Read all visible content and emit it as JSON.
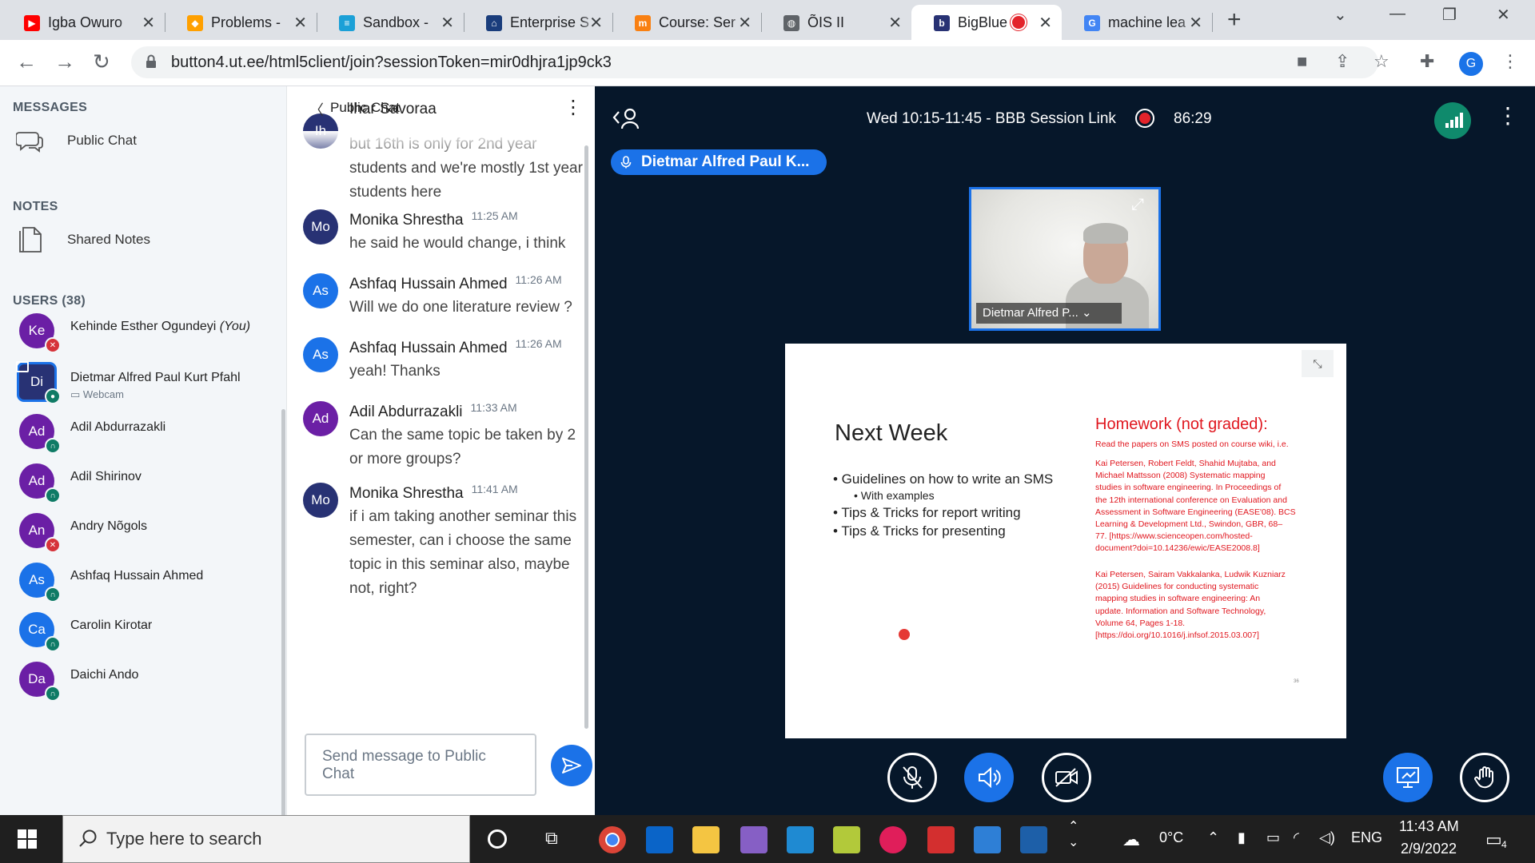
{
  "browser": {
    "tabs": [
      {
        "title": "Igba Owuro",
        "icon": "youtube-icon",
        "color": "#ff0000",
        "glyph": "▶"
      },
      {
        "title": "Problems -",
        "icon": "problems-icon",
        "color": "#ffa000",
        "glyph": "◆"
      },
      {
        "title": "Sandbox -",
        "icon": "cisco-icon",
        "color": "#1ba0d7",
        "glyph": "≡"
      },
      {
        "title": "Enterprise S",
        "icon": "building-icon",
        "color": "#1a3d7c",
        "glyph": "⌂"
      },
      {
        "title": "Course: Ser",
        "icon": "moodle-icon",
        "color": "#f98012",
        "glyph": "m"
      },
      {
        "title": "ÕIS II",
        "icon": "globe-icon",
        "color": "#5f6368",
        "glyph": "◍"
      },
      {
        "title": "BigBlue",
        "icon": "bigbluebutton-icon",
        "color": "#283274",
        "glyph": "b"
      },
      {
        "title": "machine lea",
        "icon": "google-icon",
        "color": "#4285f4",
        "glyph": "G"
      }
    ],
    "url": "button4.ut.ee/html5client/join?sessionToken=mir0dhjra1jp9ck3",
    "profile_initial": "G"
  },
  "sidebar": {
    "messages_header": "MESSAGES",
    "public_chat_label": "Public Chat",
    "notes_header": "NOTES",
    "shared_notes_label": "Shared Notes",
    "users_header": "USERS (38)",
    "users": [
      {
        "initials": "Ke",
        "name": "Kehinde Esther Ogundeyi",
        "you": "(You)",
        "color": "#6b1fa5",
        "status": "muted"
      },
      {
        "initials": "Di",
        "name": "Dietmar Alfred Paul Kurt Pfahl",
        "sub": "Webcam",
        "color": "#283274",
        "status": "talking"
      },
      {
        "initials": "Ad",
        "name": "Adil Abdurrazakli",
        "color": "#6b1fa5",
        "status": "listen"
      },
      {
        "initials": "Ad",
        "name": "Adil Shirinov",
        "color": "#6b1fa5",
        "status": "listen"
      },
      {
        "initials": "An",
        "name": "Andry Nõgols",
        "color": "#6b1fa5",
        "status": "muted"
      },
      {
        "initials": "As",
        "name": "Ashfaq Hussain Ahmed",
        "color": "#1b72e8",
        "status": "listen"
      },
      {
        "initials": "Ca",
        "name": "Carolin Kirotar",
        "color": "#1b72e8",
        "status": "listen"
      },
      {
        "initials": "Da",
        "name": "Daichi Ando",
        "color": "#6b1fa5",
        "status": "listen"
      }
    ]
  },
  "chat": {
    "title": "Public Chat",
    "cut_name": "Ihar Savoraa",
    "messages": [
      {
        "initials": "Ih",
        "color": "#283274",
        "name": "",
        "time": "",
        "text": "but 16th is only for 2nd year students and we're mostly 1st year students here"
      },
      {
        "initials": "Mo",
        "color": "#283274",
        "name": "Monika Shrestha",
        "time": "11:25 AM",
        "text": "he said he would change, i think"
      },
      {
        "initials": "As",
        "color": "#1b72e8",
        "name": "Ashfaq Hussain Ahmed",
        "time": "11:26 AM",
        "text": "Will we do one literature review ?"
      },
      {
        "initials": "As",
        "color": "#1b72e8",
        "name": "Ashfaq Hussain Ahmed",
        "time": "11:26 AM",
        "text": "yeah! Thanks"
      },
      {
        "initials": "Ad",
        "color": "#6b1fa5",
        "name": "Adil Abdurrazakli",
        "time": "11:33 AM",
        "text": "Can the same topic be taken by 2 or more groups?"
      },
      {
        "initials": "Mo",
        "color": "#283274",
        "name": "Monika Shrestha",
        "time": "11:41 AM",
        "text": "if i am taking another seminar this semester, can i choose the same topic in this seminar also, maybe not, right?"
      }
    ],
    "input_placeholder": "Send message to Public Chat"
  },
  "session": {
    "title": "Wed 10:15-11:45 - BBB Session Link",
    "recording_time": "86:29",
    "talking_label": "Dietmar Alfred Paul K...",
    "webcam_label": "Dietmar Alfred P..."
  },
  "slide": {
    "heading": "Next Week",
    "bullets": [
      "• Guidelines on how to write an SMS",
      "• Tips & Tricks for report writing",
      "• Tips & Tricks for presenting"
    ],
    "sub_bullet": "• With examples",
    "hw_title": "Homework (not graded):",
    "hw_intro": "Read the papers on SMS posted on course wiki, i.e.",
    "ref1": [
      "Kai Petersen, Robert Feldt, Shahid Mujtaba, and",
      "Michael Mattsson (2008) Systematic mapping",
      "studies in software engineering. In Proceedings of",
      "the 12th international conference on Evaluation and",
      "Assessment in Software Engineering (EASE'08). BCS",
      "Learning & Development Ltd., Swindon, GBR, 68–",
      "77. [https://www.scienceopen.com/hosted-",
      "document?doi=10.14236/ewic/EASE2008.8]"
    ],
    "ref2": [
      "Kai Petersen, Sairam Vakkalanka, Ludwik Kuzniarz",
      "(2015) Guidelines for conducting systematic",
      "mapping studies in software engineering: An",
      "update. Information and Software Technology,",
      "Volume 64, Pages 1-18.",
      "[https://doi.org/10.1016/j.infsof.2015.03.007]"
    ],
    "page_number": "36"
  },
  "taskbar": {
    "search_placeholder": "Type here to search",
    "weather": "0°C",
    "language": "ENG",
    "time": "11:43 AM",
    "date": "2/9/2022",
    "notifications": "4"
  }
}
